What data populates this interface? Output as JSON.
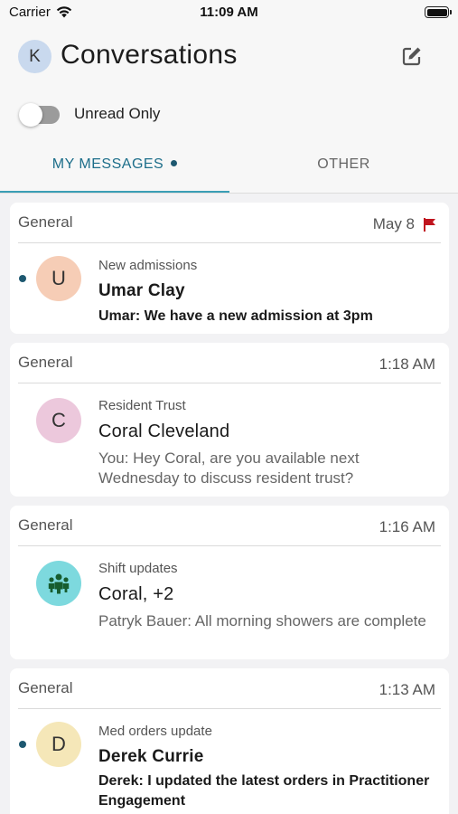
{
  "status_bar": {
    "carrier": "Carrier",
    "time": "11:09 AM"
  },
  "header": {
    "avatar_initial": "K",
    "title": "Conversations",
    "compose_icon": "compose-icon"
  },
  "filter": {
    "label": "Unread Only",
    "enabled": false
  },
  "tabs": [
    {
      "label": "MY MESSAGES",
      "active": true,
      "has_indicator": true
    },
    {
      "label": "OTHER",
      "active": false,
      "has_indicator": false
    }
  ],
  "colors": {
    "accent": "#3a9eb5",
    "active_tab": "#1d6e8a",
    "unread_dot": "#1d5870",
    "flag": "#c0141e"
  },
  "conversations": [
    {
      "category": "General",
      "time": "May 8",
      "flagged": true,
      "unread": true,
      "avatar": "U",
      "avatar_color": "#f6cdb6",
      "topic": "New admissions",
      "name": "Umar Clay",
      "preview": "Umar: We have a new admission at 3pm"
    },
    {
      "category": "General",
      "time": "1:18 AM",
      "flagged": false,
      "unread": false,
      "avatar": "C",
      "avatar_color": "#ecc8dc",
      "topic": "Resident Trust",
      "name": "Coral Cleveland",
      "preview": "You: Hey Coral, are you available next Wednesday to discuss resident trust?"
    },
    {
      "category": "General",
      "time": "1:16 AM",
      "flagged": false,
      "unread": false,
      "avatar_icon": "group-icon",
      "avatar_color": "#7dd9de",
      "topic": "Shift updates",
      "name": "Coral, +2",
      "preview": "Patryk Bauer: All morning showers are complete"
    },
    {
      "category": "General",
      "time": "1:13 AM",
      "flagged": false,
      "unread": true,
      "avatar": "D",
      "avatar_color": "#f5e7b8",
      "topic": "Med orders update",
      "name": "Derek Currie",
      "preview": "Derek: I updated the latest orders in Practitioner Engagement"
    }
  ]
}
